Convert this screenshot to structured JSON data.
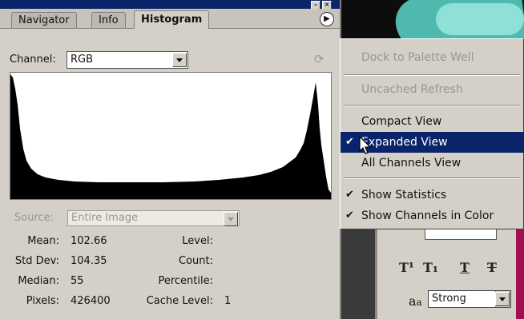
{
  "tabs": {
    "navigator": "Navigator",
    "info": "Info",
    "histogram": "Histogram"
  },
  "channel": {
    "label": "Channel:",
    "value": "RGB"
  },
  "source": {
    "label": "Source:",
    "value": "Entire Image"
  },
  "stats": {
    "mean_label": "Mean:",
    "mean": "102.66",
    "std_label": "Std Dev:",
    "std": "104.35",
    "median_label": "Median:",
    "median": "55",
    "pixels_label": "Pixels:",
    "pixels": "426400",
    "level_label": "Level:",
    "count_label": "Count:",
    "percentile_label": "Percentile:",
    "cache_label": "Cache Level:",
    "cache": "1"
  },
  "menu": {
    "dock": "Dock to Palette Well",
    "uncached": "Uncached Refresh",
    "compact": "Compact View",
    "expanded": "Expanded View",
    "all_channels": "All Channels View",
    "show_stats": "Show Statistics",
    "show_color": "Show Channels in Color"
  },
  "char_panel": {
    "aa_value": "Strong"
  },
  "colors": {
    "title_bar": "#0a246a",
    "selected": "#0a246a",
    "panel": "#d4d0c8"
  }
}
